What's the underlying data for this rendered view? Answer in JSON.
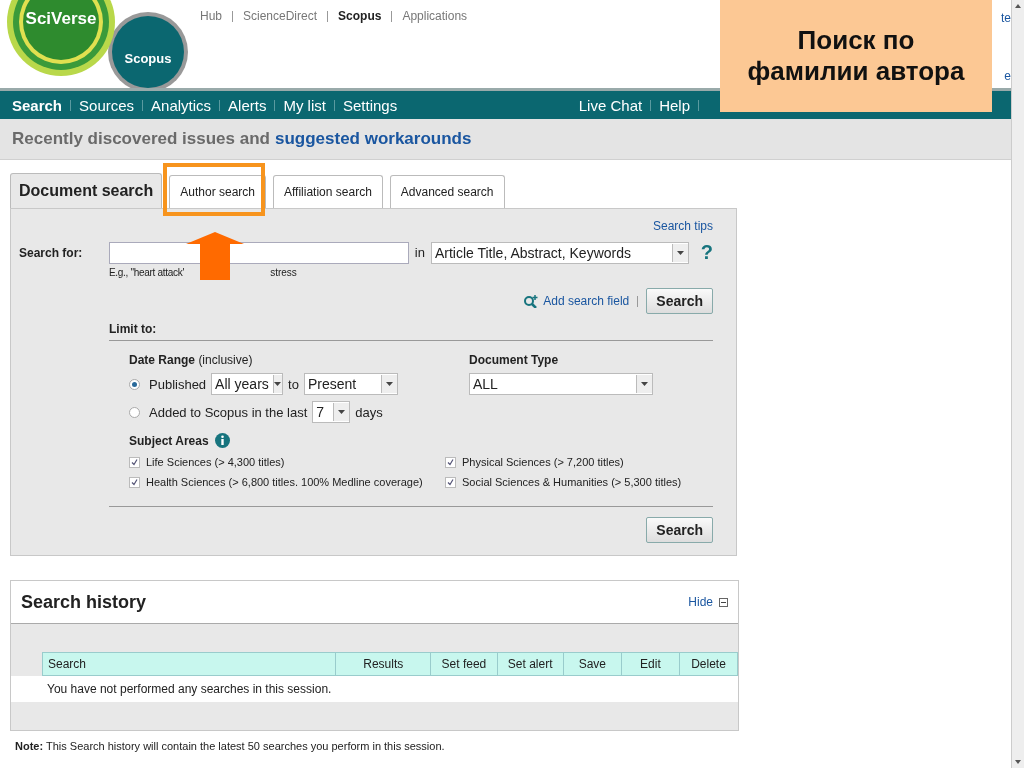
{
  "header": {
    "logo": "SciVerse",
    "product": "Scopus",
    "links": [
      {
        "label": "Hub",
        "selected": false
      },
      {
        "label": "ScienceDirect",
        "selected": false
      },
      {
        "label": "Scopus",
        "selected": true
      },
      {
        "label": "Applications",
        "selected": false
      }
    ],
    "cut_links": [
      "te",
      "e"
    ]
  },
  "nav": {
    "left": [
      {
        "label": "Search",
        "selected": true
      },
      {
        "label": "Sources",
        "selected": false
      },
      {
        "label": "Analytics",
        "selected": false
      },
      {
        "label": "Alerts",
        "selected": false
      },
      {
        "label": "My list",
        "selected": false
      },
      {
        "label": "Settings",
        "selected": false
      }
    ],
    "right": [
      "Live Chat",
      "Help"
    ]
  },
  "notice": {
    "text": "Recently discovered issues and",
    "link": "suggested workarounds"
  },
  "tabs": [
    {
      "label": "Document search",
      "selected": true
    },
    {
      "label": "Author search",
      "selected": false
    },
    {
      "label": "Affiliation search",
      "selected": false
    },
    {
      "label": "Advanced search",
      "selected": false
    }
  ],
  "search": {
    "tips": "Search tips",
    "label": "Search for:",
    "in": "in",
    "field": "Article Title, Abstract, Keywords",
    "help": "?",
    "hint": [
      "E.g., \"heart attack'",
      "stress"
    ],
    "add_field": "Add search field",
    "button": "Search"
  },
  "limit": {
    "title": "Limit to:",
    "date_label": "Date Range",
    "date_note": "(inclusive)",
    "date_options": [
      {
        "kind": "range",
        "label": "Published",
        "selected": true,
        "from": "All years",
        "to_word": "to",
        "to": "Present"
      },
      {
        "kind": "recent",
        "label": "Added to Scopus in the last",
        "selected": false,
        "value": "7",
        "suffix": "days"
      }
    ],
    "doc_type_label": "Document Type",
    "doc_type": "ALL",
    "subject_label": "Subject Areas",
    "subjects": [
      {
        "name": "Life Sciences",
        "note": "(> 4,300 titles)",
        "checked": true
      },
      {
        "name": "Physical Sciences",
        "note": "(> 7,200 titles)",
        "checked": true
      },
      {
        "name": "Health Sciences",
        "note": "(> 6,800 titles. 100% Medline coverage)",
        "checked": true
      },
      {
        "name": "Social Sciences & Humanities",
        "note": "(> 5,300 titles)",
        "checked": true
      }
    ],
    "button": "Search"
  },
  "history": {
    "title": "Search history",
    "hide": "Hide",
    "columns": [
      "Search",
      "Results",
      "Set feed",
      "Set alert",
      "Save",
      "Edit",
      "Delete"
    ],
    "empty": "You have not performed any searches in this session."
  },
  "note": "**Note:** This Search history will contain the latest 50 searches you perform in this session.",
  "callout": {
    "lines": [
      "Поиск по",
      "фамилии автора"
    ]
  }
}
